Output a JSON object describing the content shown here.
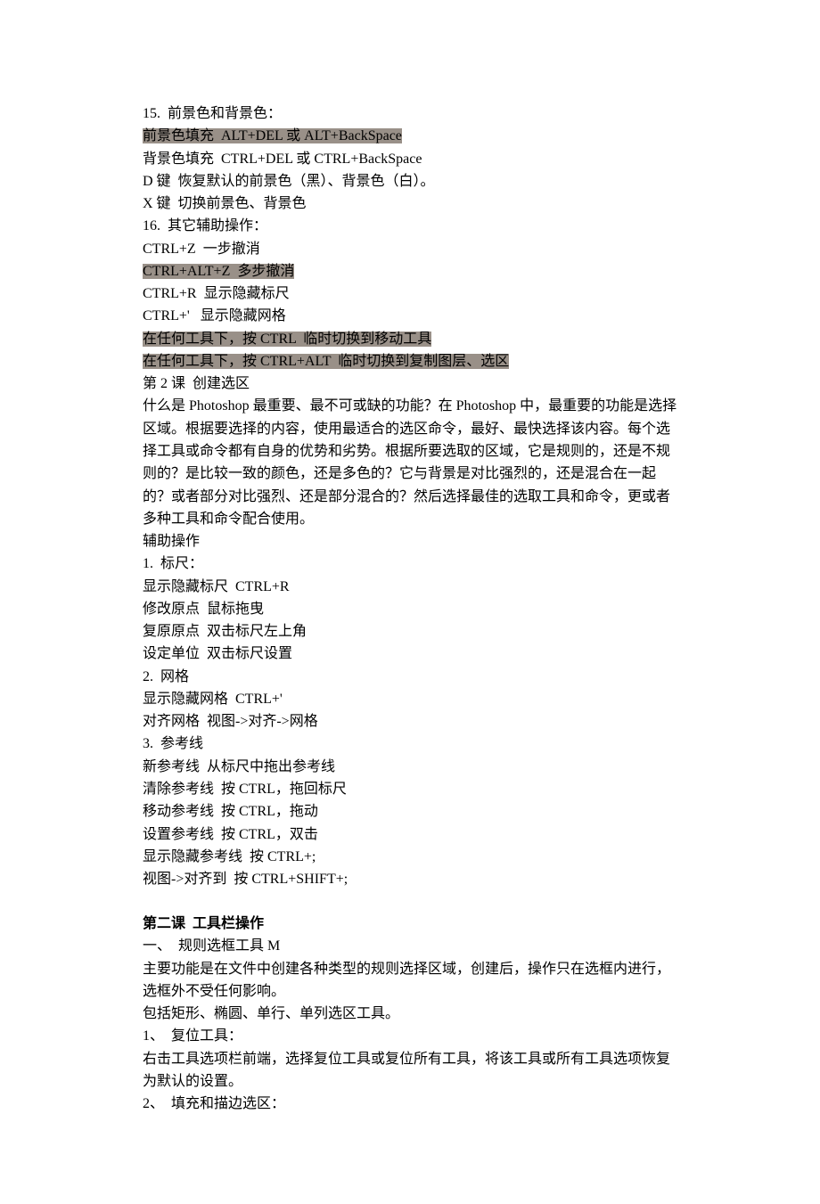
{
  "lines": [
    {
      "text": "15.  前景色和背景色："
    },
    {
      "text": "前景色填充  ALT+DEL 或 ALT+BackSpace",
      "highlight": true
    },
    {
      "text": "背景色填充  CTRL+DEL 或 CTRL+BackSpace"
    },
    {
      "text": "D 键  恢复默认的前景色（黑）、背景色（白）。"
    },
    {
      "text": "X 键  切换前景色、背景色"
    },
    {
      "text": "16.  其它辅助操作："
    },
    {
      "text": "CTRL+Z  一步撤消"
    },
    {
      "text": "CTRL+ALT+Z  多步撤消",
      "highlight": true
    },
    {
      "text": "CTRL+R  显示隐藏标尺"
    },
    {
      "text": "CTRL+'   显示隐藏网格"
    },
    {
      "text": "在任何工具下，按 CTRL  临时切换到移动工具",
      "highlight": true
    },
    {
      "text": "在任何工具下，按 CTRL+ALT  临时切换到复制图层、选区",
      "highlight": true
    },
    {
      "text": "第 2 课  创建选区"
    },
    {
      "text": "什么是 Photoshop 最重要、最不可或缺的功能？在 Photoshop 中，最重要的功能是选择区域。根据要选择的内容，使用最适合的选区命令，最好、最快选择该内容。每个选择工具或命令都有自身的优势和劣势。根据所要选取的区域，它是规则的，还是不规则的？是比较一致的颜色，还是多色的？它与背景是对比强烈的，还是混合在一起的？或者部分对比强烈、还是部分混合的？然后选择最佳的选取工具和命令，更或者多种工具和命令配合使用。"
    },
    {
      "text": "辅助操作"
    },
    {
      "text": "1.  标尺："
    },
    {
      "text": "显示隐藏标尺  CTRL+R"
    },
    {
      "text": "修改原点  鼠标拖曳"
    },
    {
      "text": "复原原点  双击标尺左上角"
    },
    {
      "text": "设定单位  双击标尺设置"
    },
    {
      "text": "2.  网格"
    },
    {
      "text": "显示隐藏网格  CTRL+'"
    },
    {
      "text": "对齐网格  视图->对齐->网格"
    },
    {
      "text": "3.  参考线"
    },
    {
      "text": "新参考线  从标尺中拖出参考线"
    },
    {
      "text": "清除参考线  按 CTRL，拖回标尺"
    },
    {
      "text": "移动参考线  按 CTRL，拖动"
    },
    {
      "text": "设置参考线  按 CTRL，双击"
    },
    {
      "text": "显示隐藏参考线  按 CTRL+;"
    },
    {
      "text": "视图->对齐到  按 CTRL+SHIFT+;"
    },
    {
      "spacer": true
    },
    {
      "text": "第二课  工具栏操作",
      "bold": true
    },
    {
      "text": "一、  规则选框工具 M"
    },
    {
      "text": "主要功能是在文件中创建各种类型的规则选择区域，创建后，操作只在选框内进行，选框外不受任何影响。"
    },
    {
      "text": "包括矩形、椭圆、单行、单列选区工具。"
    },
    {
      "text": "1、  复位工具："
    },
    {
      "text": "右击工具选项栏前端，选择复位工具或复位所有工具，将该工具或所有工具选项恢复为默认的设置。"
    },
    {
      "text": "2、  填充和描边选区："
    }
  ]
}
